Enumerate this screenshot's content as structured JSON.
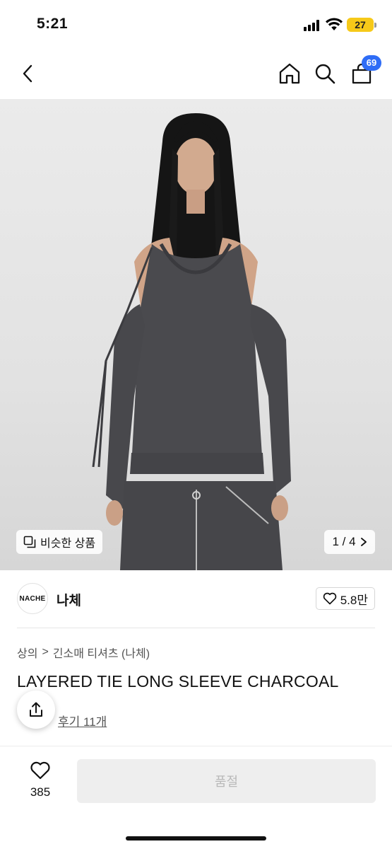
{
  "status": {
    "time": "5:21",
    "battery": "27"
  },
  "nav": {
    "cart_count": "69"
  },
  "gallery": {
    "similar_label": "비슷한 상품",
    "page_indicator": "1 / 4"
  },
  "brand": {
    "logo_text": "NACHE",
    "name": "나체",
    "likes": "5.8만"
  },
  "breadcrumb": {
    "category": "상의",
    "separator": ">",
    "subcategory": "긴소매 티셔츠 (나체)"
  },
  "product": {
    "title": "LAYERED TIE LONG SLEEVE CHARCOAL",
    "reviews": "후기 11개"
  },
  "bottom": {
    "wish_count": "385",
    "soldout_label": "품절"
  },
  "colors": {
    "accent_blue": "#2f6df6",
    "battery_yellow": "#f6c919",
    "garment_charcoal": "#4a4a4e"
  }
}
